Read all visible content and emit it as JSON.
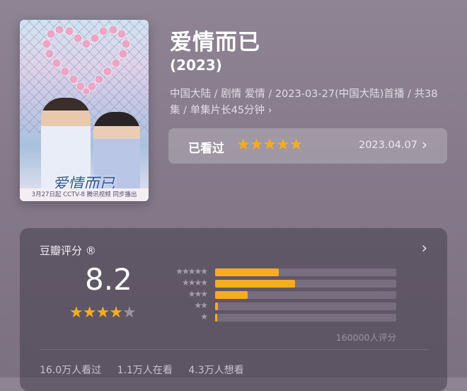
{
  "poster": {
    "title_art": "爱情而已",
    "caption": "3月27日起 CCTV-8 腾讯视频 同步播出"
  },
  "title": "爱情而已",
  "year": "(2023)",
  "meta": "中国大陆 / 剧情 爱情 / 2023-03-27(中国大陆)首播 / 共38集 / 单集片长45分钟 ›",
  "watched": {
    "label": "已看过",
    "stars": 5,
    "date": "2023.04.07"
  },
  "rating": {
    "title": "豆瓣评分 ®",
    "score": "8.2",
    "star_rating": 4,
    "distribution": [
      {
        "stars": "★★★★★",
        "fraction": 0.35
      },
      {
        "stars": "★★★★",
        "fraction": 0.44
      },
      {
        "stars": "★★★",
        "fraction": 0.18
      },
      {
        "stars": "★★",
        "fraction": 0.015
      },
      {
        "stars": "★",
        "fraction": 0.01
      }
    ],
    "count": "160000人评分",
    "stats": [
      "16.0万人看过",
      "1.1万人在看",
      "4.3万人想看"
    ]
  },
  "colors": {
    "accent": "#f6ad1c",
    "card_bg": "#463e4c"
  }
}
